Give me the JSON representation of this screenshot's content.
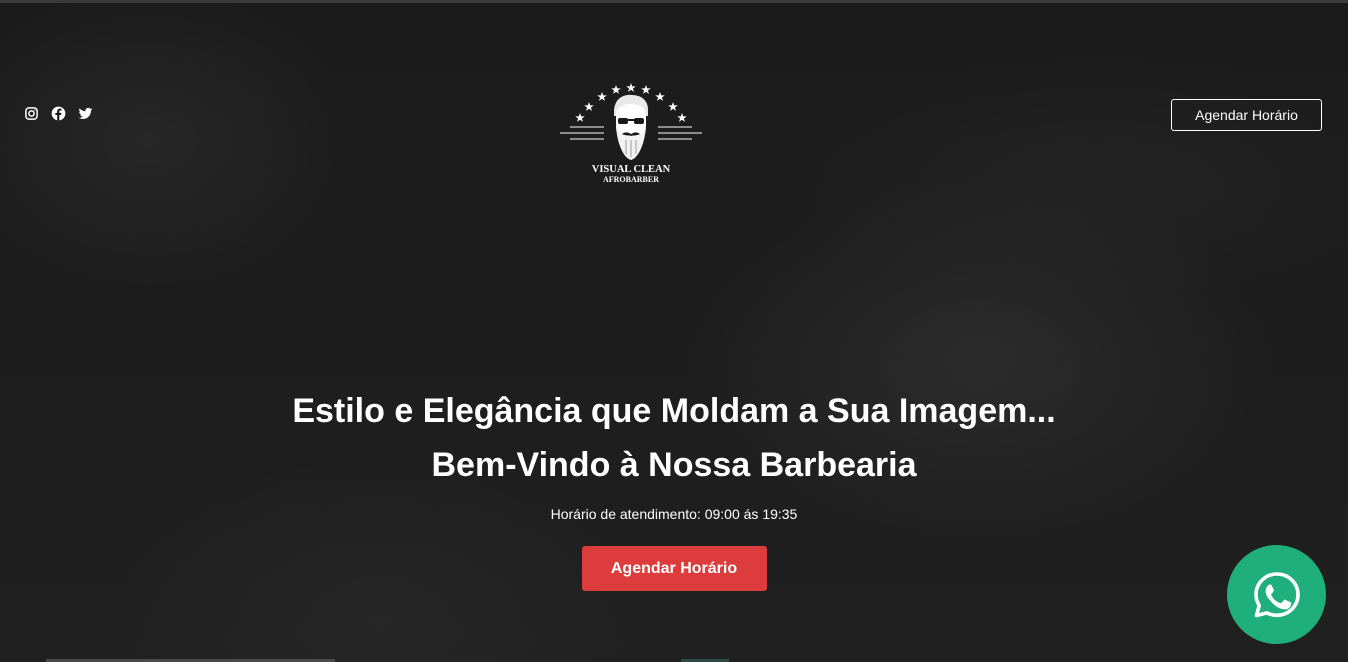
{
  "header": {
    "social": [
      {
        "name": "instagram-icon"
      },
      {
        "name": "facebook-icon"
      },
      {
        "name": "twitter-icon"
      }
    ],
    "logo": {
      "line1": "VISUAL CLEAN",
      "line2": "AFROBARBER",
      "icon": "bearded-man-logo"
    },
    "cta_label": "Agendar Horário"
  },
  "hero": {
    "title_line1": "Estilo e Elegância que Moldam a Sua Imagem...",
    "title_line2": "Bem-Vindo à Nossa Barbearia",
    "hours": "Horário de atendimento: 09:00 ás 19:35",
    "cta_label": "Agendar Horário"
  },
  "floating": {
    "whatsapp_icon": "whatsapp-icon"
  },
  "colors": {
    "background": "#191919",
    "accent_red": "#dc3c3c",
    "whatsapp_green": "#1faf7d",
    "text": "#ffffff"
  }
}
